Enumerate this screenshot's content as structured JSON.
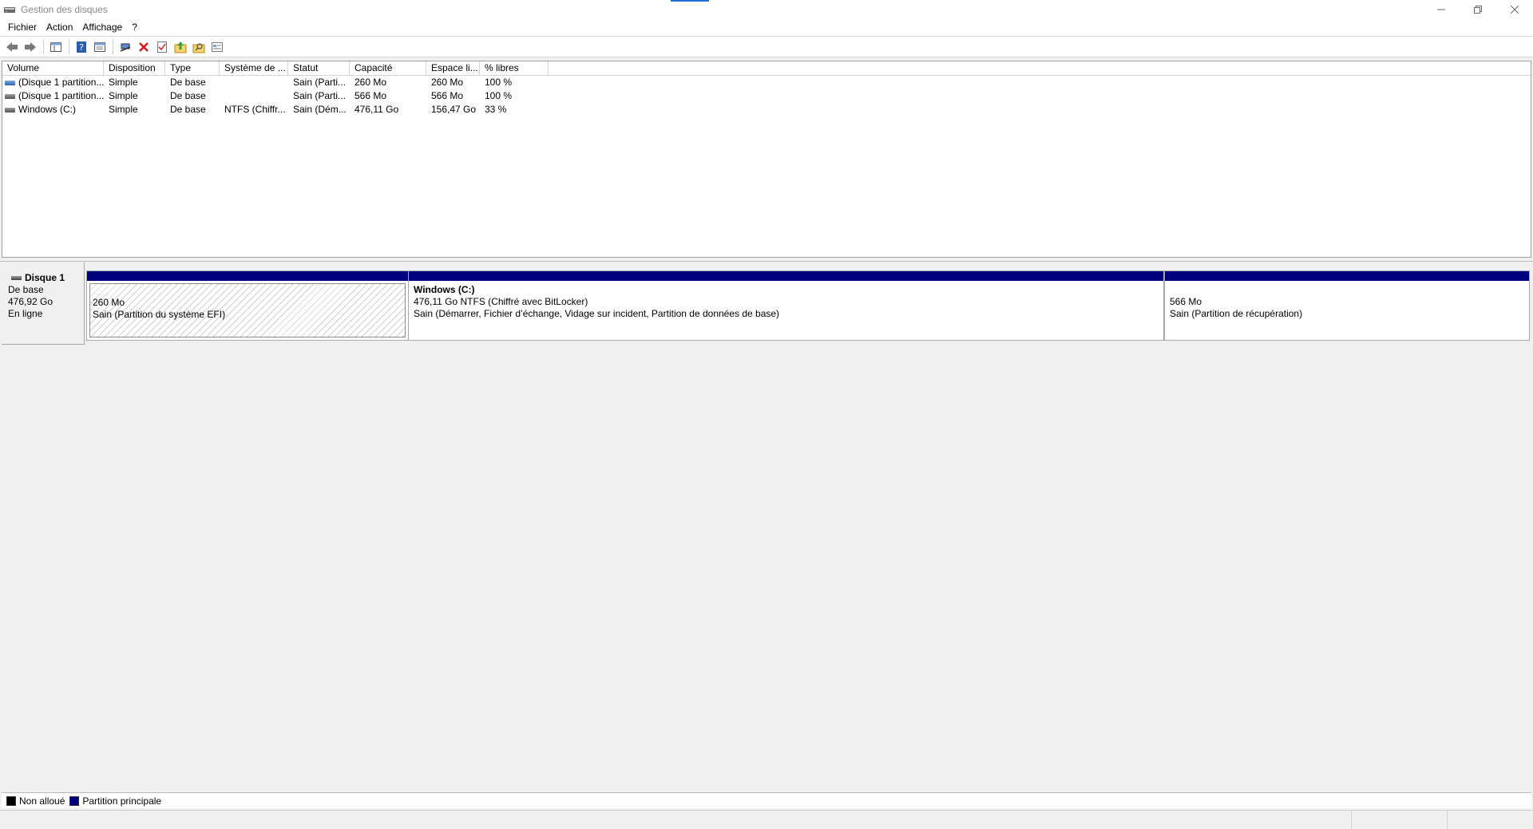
{
  "window": {
    "title": "Gestion des disques"
  },
  "menu": [
    "Fichier",
    "Action",
    "Affichage",
    "?"
  ],
  "toolbar": {
    "buttons": [
      "back-arrow-icon",
      "forward-arrow-icon",
      "console-tree-icon",
      "help-icon",
      "properties-icon",
      "connect-icon",
      "delete-icon",
      "check-icon",
      "folder-up-icon",
      "folder-search-icon",
      "view-icon"
    ]
  },
  "volume_list": {
    "columns": [
      "Volume",
      "Disposition",
      "Type",
      "Système de ...",
      "Statut",
      "Capacité",
      "Espace li...",
      "% libres"
    ],
    "rows": [
      [
        "(Disque 1 partition...",
        "Simple",
        "De base",
        "",
        "Sain (Parti...",
        "260 Mo",
        "260 Mo",
        "100 %"
      ],
      [
        "(Disque 1 partition...",
        "Simple",
        "De base",
        "",
        "Sain (Parti...",
        "566 Mo",
        "566 Mo",
        "100 %"
      ],
      [
        "Windows (C:)",
        "Simple",
        "De base",
        "NTFS (Chiffr...",
        "Sain (Dém...",
        "476,11 Go",
        "156,47 Go",
        "33 %"
      ]
    ]
  },
  "disk": {
    "name": "Disque 1",
    "type": "De base",
    "size": "476,92 Go",
    "status": "En ligne",
    "partitions": [
      {
        "name": "",
        "size": "260 Mo",
        "status": "Sain (Partition du système EFI)"
      },
      {
        "name": "Windows  (C:)",
        "size": "476,11 Go NTFS (Chiffré avec BitLocker)",
        "status": "Sain (Démarrer, Fichier d’échange, Vidage sur incident, Partition de données de base)"
      },
      {
        "name": "",
        "size": "566 Mo",
        "status": "Sain (Partition de récupération)"
      }
    ]
  },
  "legend": {
    "unallocated": "Non alloué",
    "primary": "Partition principale",
    "unallocated_color": "#000000",
    "primary_color": "#00007e"
  },
  "colors": {
    "partition_bar": "#00007e",
    "accent": "#1e6fd9"
  }
}
